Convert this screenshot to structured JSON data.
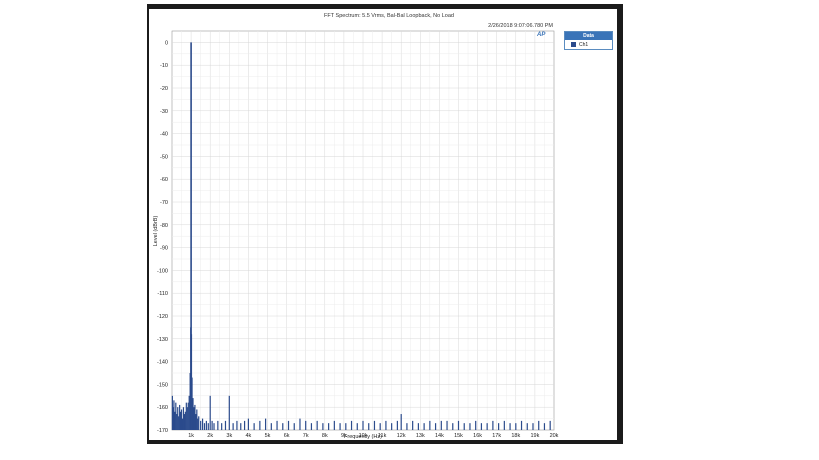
{
  "chart_data": {
    "type": "bar",
    "title": "FFT Spectrum: 5.5 Vrms, Bal-Bal Loopback, No Load",
    "timestamp": "2/26/2018 9:07:06.780 PM",
    "xlabel": "Frequency (Hz)",
    "ylabel": "Level (dBrB)",
    "xlim": [
      0,
      20000
    ],
    "ylim": [
      -170,
      5
    ],
    "grid": true,
    "x_tick_values": [
      1000,
      2000,
      3000,
      4000,
      5000,
      6000,
      7000,
      8000,
      9000,
      10000,
      11000,
      12000,
      13000,
      14000,
      15000,
      16000,
      17000,
      18000,
      19000,
      20000
    ],
    "x_tick_labels": [
      "1k",
      "2k",
      "3k",
      "4k",
      "5k",
      "6k",
      "7k",
      "8k",
      "9k",
      "10k",
      "11k",
      "12k",
      "13k",
      "14k",
      "15k",
      "16k",
      "17k",
      "18k",
      "19k",
      "20k"
    ],
    "y_tick_values": [
      0,
      -10,
      -20,
      -30,
      -40,
      -50,
      -60,
      -70,
      -80,
      -90,
      -100,
      -110,
      -120,
      -130,
      -140,
      -150,
      -160,
      -170
    ],
    "y_tick_labels": [
      "0",
      "-10",
      "-20",
      "-30",
      "-40",
      "-50",
      "-60",
      "-70",
      "-80",
      "-90",
      "-100",
      "-110",
      "-120",
      "-130",
      "-140",
      "-150",
      "-160",
      "-170"
    ],
    "legend": {
      "title": "Data",
      "placement": "right",
      "entries": [
        {
          "name": "Ch1",
          "color": "#2b4b8c"
        }
      ]
    },
    "series": [
      {
        "name": "Ch1",
        "color": "#2b4b8c",
        "x": [
          20,
          60,
          100,
          150,
          200,
          250,
          300,
          350,
          400,
          450,
          500,
          550,
          600,
          650,
          700,
          750,
          800,
          850,
          900,
          950,
          980,
          1000,
          1020,
          1050,
          1100,
          1150,
          1200,
          1250,
          1300,
          1350,
          1400,
          1500,
          1600,
          1700,
          1800,
          1900,
          2000,
          2100,
          2200,
          2400,
          2600,
          2800,
          3000,
          3200,
          3400,
          3600,
          3800,
          4000,
          4300,
          4600,
          4900,
          5200,
          5500,
          5800,
          6100,
          6400,
          6700,
          7000,
          7300,
          7600,
          7900,
          8200,
          8500,
          8800,
          9100,
          9400,
          9700,
          10000,
          10300,
          10600,
          10900,
          11200,
          11500,
          11800,
          12000,
          12300,
          12600,
          12900,
          13200,
          13500,
          13800,
          14100,
          14400,
          14700,
          15000,
          15300,
          15600,
          15900,
          16200,
          16500,
          16800,
          17100,
          17400,
          17700,
          18000,
          18300,
          18600,
          18900,
          19200,
          19500,
          19800
        ],
        "values": [
          -155,
          -160,
          -157,
          -162,
          -158,
          -163,
          -160,
          -164,
          -159,
          -162,
          -161,
          -165,
          -160,
          -163,
          -162,
          -158,
          -160,
          -158,
          -155,
          -145,
          -125,
          0,
          -128,
          -147,
          -156,
          -160,
          -159,
          -163,
          -161,
          -165,
          -164,
          -166,
          -165,
          -167,
          -166,
          -167,
          -155,
          -166,
          -167,
          -166,
          -167,
          -166,
          -155,
          -167,
          -166,
          -167,
          -166,
          -165,
          -167,
          -166,
          -165,
          -167,
          -166,
          -167,
          -166,
          -167,
          -165,
          -166,
          -167,
          -166,
          -167,
          -167,
          -166,
          -167,
          -167,
          -166,
          -167,
          -166,
          -167,
          -166,
          -167,
          -166,
          -167,
          -166,
          -163,
          -167,
          -166,
          -167,
          -167,
          -166,
          -167,
          -166,
          -166,
          -167,
          -166,
          -167,
          -167,
          -166,
          -167,
          -167,
          -166,
          -167,
          -166,
          -167,
          -167,
          -166,
          -167,
          -167,
          -166,
          -167,
          -166
        ]
      }
    ]
  }
}
